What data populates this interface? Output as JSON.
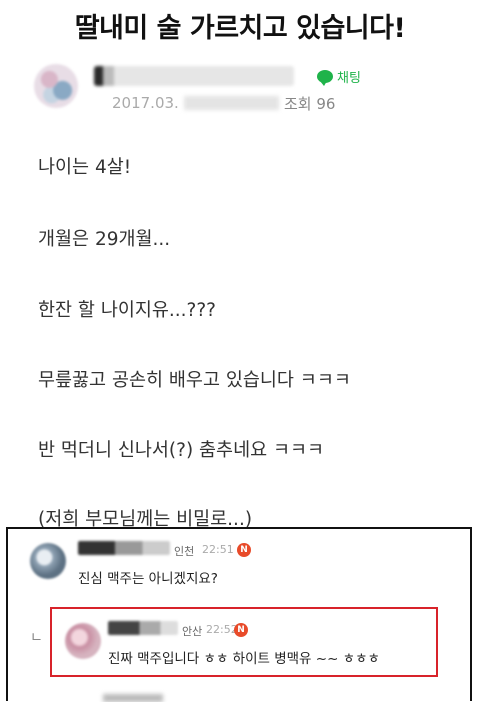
{
  "post": {
    "title": "딸내미 술 가르치고 있습니다!",
    "date": "2017.03.",
    "views": "조회 96",
    "chat_label": "채팅",
    "body_lines": [
      "나이는 4살!",
      "개월은 29개월...",
      "한잔 할 나이지유...???",
      "무릎꿇고 공손히 배우고 있습니다 ㅋㅋㅋ",
      "반 먹더니 신나서(?) 춤추네요 ㅋㅋㅋ",
      "(저희 부모님께는 비밀로...)"
    ]
  },
  "comments": [
    {
      "location": "인천",
      "time": "22:51",
      "badge": "N",
      "text": "진심 맥주는 아니겠지요?"
    },
    {
      "location": "안산",
      "time": "22:52",
      "badge": "N",
      "text": "진짜 맥주입니다 ㅎㅎ 하이트 병맥유 ~~ ㅎㅎㅎ",
      "reply_marker": "ㄴ"
    }
  ],
  "colors": {
    "chat_green": "#1fb34a",
    "badge_red": "#e84b2a",
    "highlight_red": "#d8232a"
  }
}
